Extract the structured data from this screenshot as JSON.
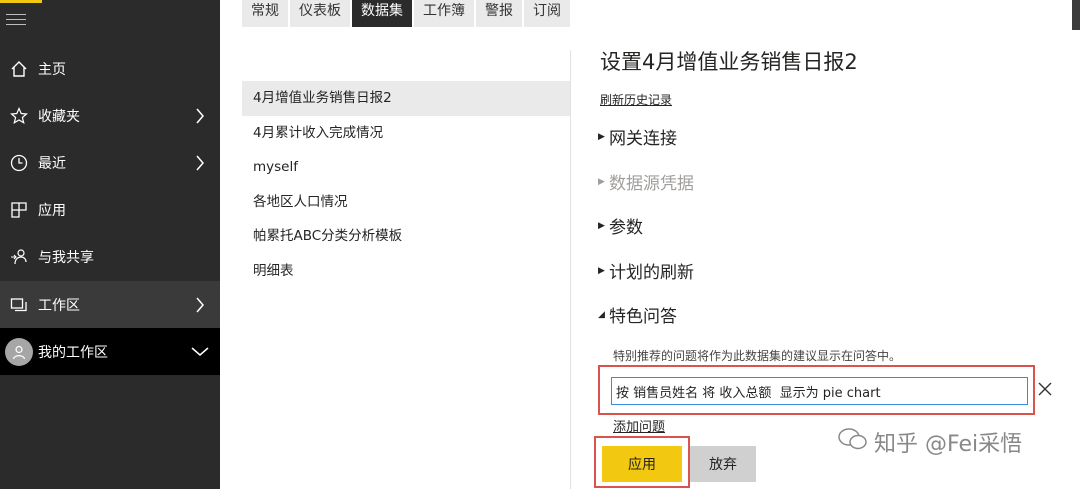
{
  "sidebar": {
    "items": [
      {
        "label": "主页",
        "icon": "home-icon"
      },
      {
        "label": "收藏夹",
        "icon": "star-icon"
      },
      {
        "label": "最近",
        "icon": "clock-icon"
      },
      {
        "label": "应用",
        "icon": "apps-icon"
      },
      {
        "label": "与我共享",
        "icon": "share-icon"
      },
      {
        "label": "工作区",
        "icon": "workspace-icon"
      },
      {
        "label": "我的工作区",
        "icon": "avatar-icon"
      }
    ]
  },
  "tabs": [
    "常规",
    "仪表板",
    "数据集",
    "工作簿",
    "警报",
    "订阅"
  ],
  "selected_tab": "数据集",
  "datasets": [
    "4月增值业务销售日报2",
    "4月累计收入完成情况",
    "myself",
    "各地区人口情况",
    "帕累托ABC分类分析模板",
    "明细表"
  ],
  "settings": {
    "title": "设置4月增值业务销售日报2",
    "history_link": "刷新历史记录",
    "sections": [
      "网关连接",
      "数据源凭据",
      "参数",
      "计划的刷新",
      "特色问答"
    ],
    "featured_desc": "特别推荐的问题将作为此数据集的建议显示在问答中。",
    "question_value": "按 销售员姓名 将 收入总额  显示为 pie chart",
    "add_question": "添加问题",
    "apply_label": "应用",
    "discard_label": "放弃"
  },
  "watermark": "知乎 @Fei采悟",
  "colors": {
    "accent": "#f2c811",
    "sidebar": "#2b2b2b",
    "highlight": "#d9534f"
  }
}
